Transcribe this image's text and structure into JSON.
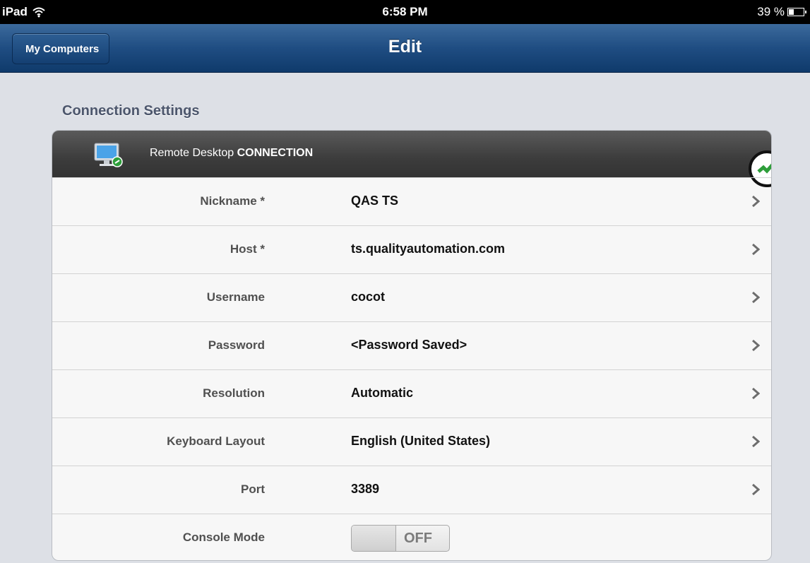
{
  "status_bar": {
    "device": "iPad",
    "time": "6:58 PM",
    "battery": "39 %",
    "battery_level": 0.39
  },
  "nav": {
    "back_label": "My Computers",
    "title": "Edit"
  },
  "section": {
    "title": "Connection Settings"
  },
  "card": {
    "header_prefix": "Remote Desktop ",
    "header_strong": "CONNECTION",
    "rows": [
      {
        "key": "Nickname *",
        "value": "QAS TS"
      },
      {
        "key": "Host *",
        "value": "ts.qualityautomation.com"
      },
      {
        "key": "Username",
        "value": "cocot"
      },
      {
        "key": "Password",
        "value": "<Password Saved>"
      },
      {
        "key": "Resolution",
        "value": "Automatic"
      },
      {
        "key": "Keyboard Layout",
        "value": "English (United States)"
      },
      {
        "key": "Port",
        "value": "3389"
      }
    ],
    "console_mode": {
      "key": "Console Mode",
      "state": "OFF"
    }
  },
  "icons": {
    "wifi": "wifi-icon",
    "battery": "battery-icon",
    "monitor": "remote-desktop-monitor-icon",
    "chevron": "chevron-right-icon",
    "badge": "connection-badge-icon"
  },
  "colors": {
    "nav_blue": "#1f4d82",
    "header_gray": "#3c3c3c",
    "badge_green": "#2e9e3a"
  }
}
